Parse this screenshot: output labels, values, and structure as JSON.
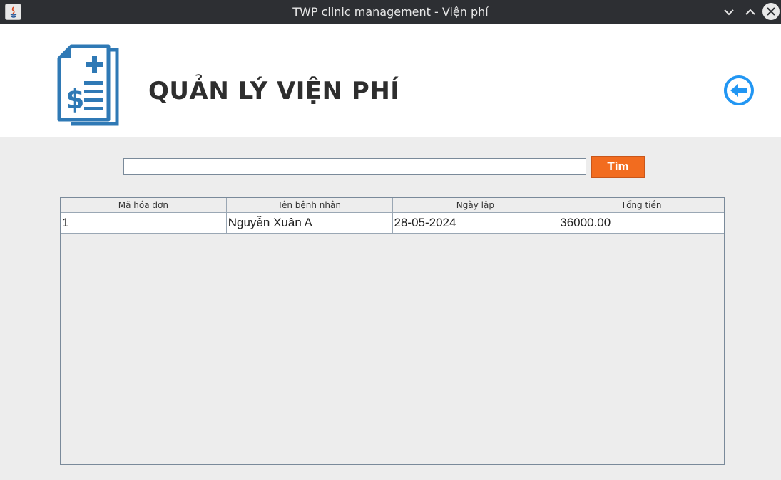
{
  "window": {
    "title": "TWP clinic management - Viện phí",
    "icons": {
      "app": "java-icon",
      "minimize": "chevron-down-icon",
      "maximize": "chevron-up-icon",
      "close": "close-icon"
    }
  },
  "header": {
    "title": "QUẢN LÝ VIỆN PHÍ",
    "logo_icon": "medical-bill-icon",
    "back_icon": "back-arrow-icon",
    "accent_color": "#2f79b5",
    "back_color": "#2196f3"
  },
  "search": {
    "value": "",
    "placeholder": "",
    "button_label": "Tìm",
    "button_color": "#f26c1f"
  },
  "table": {
    "columns": [
      "Mã hóa đơn",
      "Tên bệnh nhân",
      "Ngày lập",
      "Tổng tiền"
    ],
    "rows": [
      [
        "1",
        "Nguyễn Xuân A",
        "28-05-2024",
        "36000.00"
      ]
    ]
  }
}
